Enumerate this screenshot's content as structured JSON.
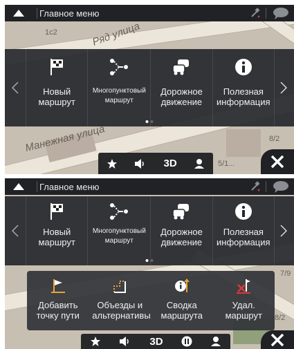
{
  "screen1": {
    "topbar": {
      "title": "Главное меню"
    },
    "map": {
      "street1": "Ряд улица",
      "street2": "Манежная улица",
      "num1": "1с2",
      "num2": "5/1...",
      "num3": "8/2"
    },
    "menu": [
      {
        "label": "Новый маршрут",
        "icon": "checkered-flag-icon"
      },
      {
        "label": "Многопунктовый маршрут",
        "icon": "multipoint-route-icon"
      },
      {
        "label": "Дорожное движение",
        "icon": "traffic-icon"
      },
      {
        "label": "Полезная информация",
        "icon": "info-icon"
      }
    ],
    "bottombar": {
      "view_mode": "3D"
    }
  },
  "screen2": {
    "topbar": {
      "title": "Главное меню"
    },
    "menu": [
      {
        "label": "Новый маршрут",
        "icon": "checkered-flag-icon"
      },
      {
        "label": "Многопунктовый маршрут",
        "icon": "multipoint-route-icon"
      },
      {
        "label": "Дорожное движение",
        "icon": "traffic-icon"
      },
      {
        "label": "Полезная информация",
        "icon": "info-icon"
      }
    ],
    "submenu": [
      {
        "label": "Добавить точку пути",
        "icon": "add-waypoint-icon"
      },
      {
        "label": "Объезды и альтернативы",
        "icon": "detour-icon"
      },
      {
        "label": "Сводка маршрута",
        "icon": "route-summary-icon"
      },
      {
        "label": "Удал. маршрут",
        "icon": "delete-route-icon"
      }
    ],
    "map": {
      "num1": "8/2",
      "num2": "7/9"
    },
    "bottombar": {
      "view_mode": "3D"
    }
  },
  "colors": {
    "accent": "#e8a43a",
    "panel": "#26282c",
    "map": "#c8bfb3",
    "delete": "#d93a3a"
  }
}
